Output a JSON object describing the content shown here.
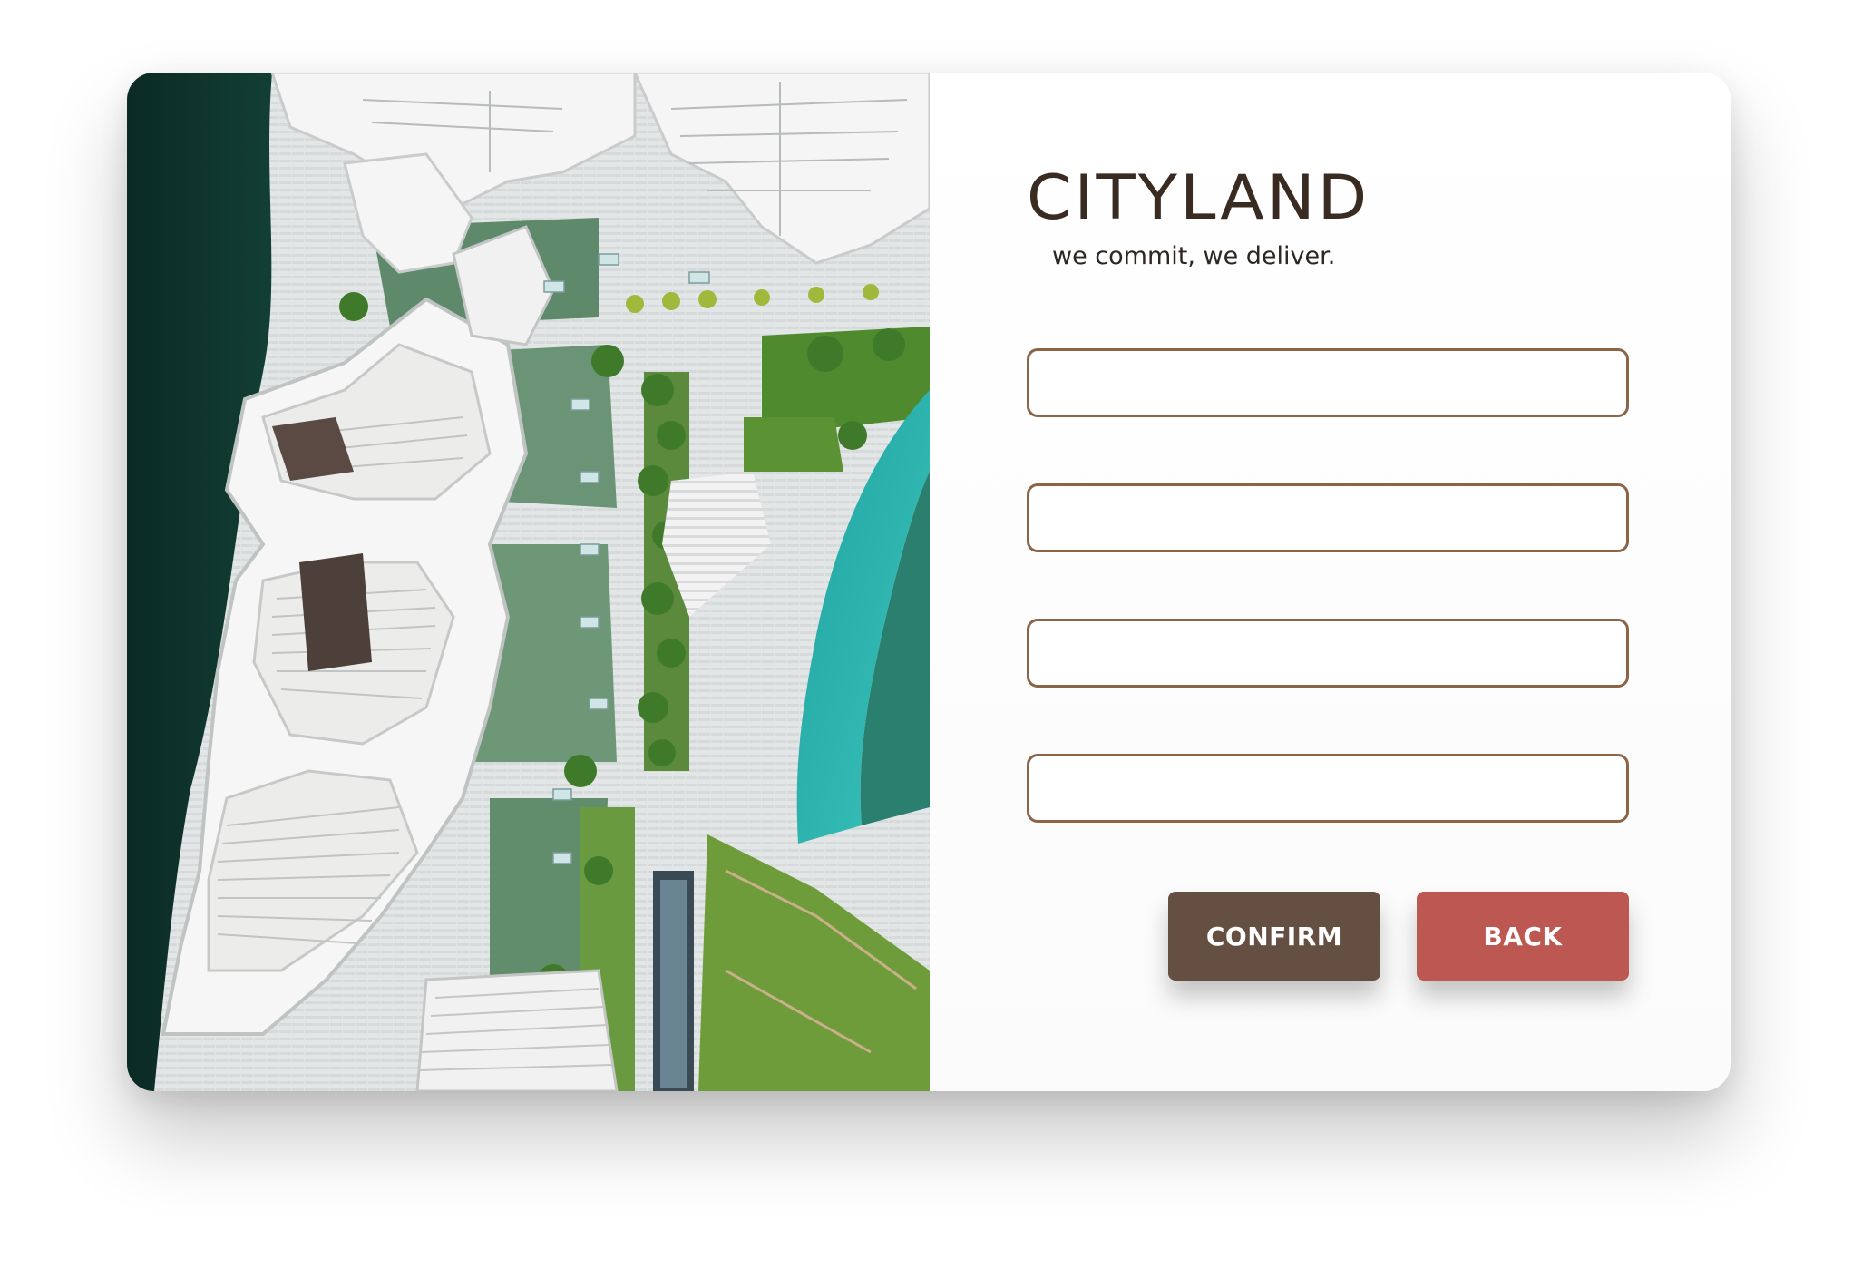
{
  "brand": {
    "name": "CITYLAND",
    "tagline": "we commit, we deliver."
  },
  "hero_image": {
    "description_icon": "aerial-city-photo"
  },
  "form": {
    "fields": [
      {
        "value": "",
        "placeholder": ""
      },
      {
        "value": "",
        "placeholder": ""
      },
      {
        "value": "",
        "placeholder": ""
      },
      {
        "value": "",
        "placeholder": ""
      }
    ],
    "confirm_label": "CONFIRM",
    "back_label": "BACK"
  },
  "colors": {
    "confirm_button": "#654f42",
    "back_button": "#bc5752",
    "field_border": "#8a6548",
    "brand_text": "#3a2b22"
  }
}
